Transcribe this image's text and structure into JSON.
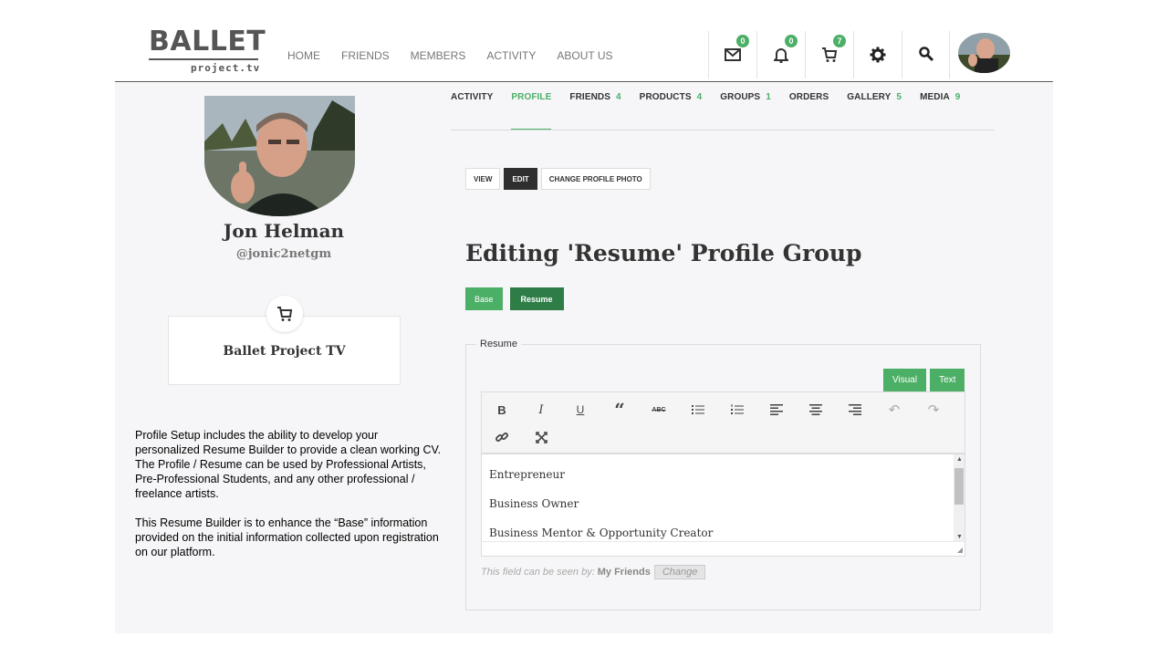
{
  "brand": {
    "name": "BALLET",
    "sub": "project.tv"
  },
  "main_nav": [
    "HOME",
    "FRIENDS",
    "MEMBERS",
    "ACTIVITY",
    "ABOUT US"
  ],
  "header_icons": [
    {
      "icon": "mail-icon",
      "badge": "0"
    },
    {
      "icon": "bell-icon",
      "badge": "0"
    },
    {
      "icon": "cart-icon",
      "badge": "7"
    },
    {
      "icon": "gear-icon",
      "badge": ""
    },
    {
      "icon": "search-icon",
      "badge": ""
    }
  ],
  "profile": {
    "name": "Jon Helman",
    "handle": "@jonic2netgm"
  },
  "shop": {
    "name": "Ballet Project TV"
  },
  "tabs": [
    {
      "label": "ACTIVITY",
      "count": ""
    },
    {
      "label": "PROFILE",
      "count": ""
    },
    {
      "label": "FRIENDS",
      "count": "4"
    },
    {
      "label": "PRODUCTS",
      "count": "4"
    },
    {
      "label": "GROUPS",
      "count": "1"
    },
    {
      "label": "ORDERS",
      "count": ""
    },
    {
      "label": "GALLERY",
      "count": "5"
    },
    {
      "label": "MEDIA",
      "count": "9"
    }
  ],
  "sub_buttons": [
    "VIEW",
    "EDIT",
    "CHANGE PROFILE PHOTO"
  ],
  "page_title": "Editing 'Resume' Profile Group",
  "group_buttons": [
    "Base",
    "Resume"
  ],
  "field": {
    "legend": "Resume",
    "modes": [
      "Visual",
      "Text"
    ],
    "lines": [
      "Entrepreneur",
      "Business Owner",
      "Business Mentor & Opportunity Creator"
    ],
    "visibility_label": "This field can be seen by:",
    "visibility_value": "My Friends",
    "change_label": "Change"
  },
  "caption": {
    "p1": "Profile Setup includes  the ability to develop  your personalized Resume Builder to provide  a clean working CV.  The Profile / Resume can be used by Professional Artists, Pre-Professional  Students, and any other professional  / freelance  artists.",
    "p2": "This Resume Builder is to enhance the “Base” information provided  on the initial information collected upon registration on our platform."
  },
  "colors": {
    "accent": "#4caf66",
    "accent_dark": "#2e7d47",
    "dark_button": "#2f2f2f"
  }
}
